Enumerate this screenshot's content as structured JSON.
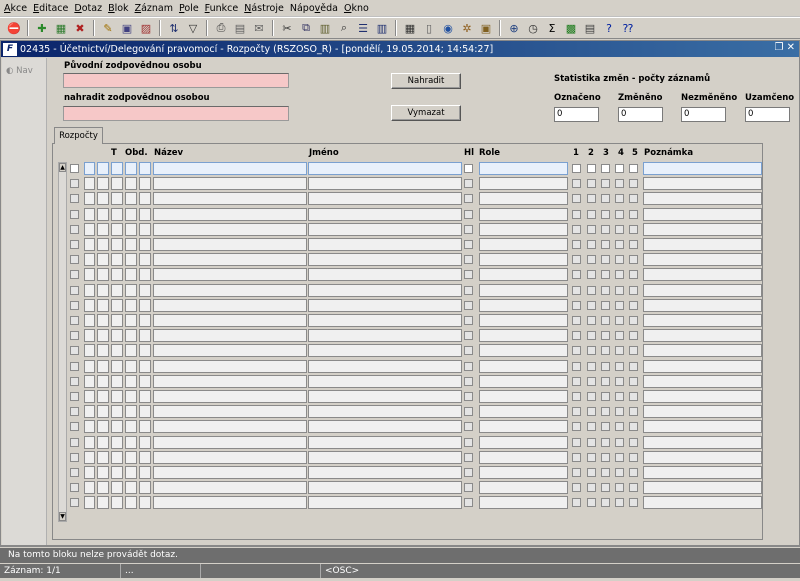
{
  "menu": [
    {
      "id": "akce",
      "pre": "",
      "u": "A",
      "post": "kce"
    },
    {
      "id": "editace",
      "pre": "",
      "u": "E",
      "post": "ditace"
    },
    {
      "id": "dotaz",
      "pre": "",
      "u": "D",
      "post": "otaz"
    },
    {
      "id": "blok",
      "pre": "",
      "u": "B",
      "post": "lok"
    },
    {
      "id": "zaznam",
      "pre": "",
      "u": "Z",
      "post": "áznam"
    },
    {
      "id": "pole",
      "pre": "",
      "u": "P",
      "post": "ole"
    },
    {
      "id": "funkce",
      "pre": "",
      "u": "F",
      "post": "unkce"
    },
    {
      "id": "nastroje",
      "pre": "",
      "u": "N",
      "post": "ástroje"
    },
    {
      "id": "napoveda",
      "pre": "Nápo",
      "u": "v",
      "post": "ěda"
    },
    {
      "id": "okno",
      "pre": "",
      "u": "O",
      "post": "kno"
    }
  ],
  "toolbar": [
    {
      "name": "exit-icon",
      "glyph": "⛔",
      "color": "#cc0000"
    },
    {
      "sep": true
    },
    {
      "name": "new-record-icon",
      "glyph": "✚",
      "color": "#2a8a2a"
    },
    {
      "name": "save-icon",
      "glyph": "▦",
      "color": "#2a7a2a"
    },
    {
      "name": "delete-record-icon",
      "glyph": "✖",
      "color": "#b02020"
    },
    {
      "sep": true
    },
    {
      "name": "enter-query-icon",
      "glyph": "✎",
      "color": "#a07000"
    },
    {
      "name": "execute-query-icon",
      "glyph": "▣",
      "color": "#404080"
    },
    {
      "name": "cancel-query-icon",
      "glyph": "▨",
      "color": "#a03030"
    },
    {
      "sep": true
    },
    {
      "name": "sort-icon",
      "glyph": "⇅",
      "color": "#203070"
    },
    {
      "name": "filter-icon",
      "glyph": "▽",
      "color": "#303030"
    },
    {
      "sep": true
    },
    {
      "name": "print-icon",
      "glyph": "⎙",
      "color": "#404040"
    },
    {
      "name": "attachment-icon",
      "glyph": "▤",
      "color": "#606060"
    },
    {
      "name": "mail-icon",
      "glyph": "✉",
      "color": "#606060"
    },
    {
      "sep": true
    },
    {
      "name": "cut-icon",
      "glyph": "✂",
      "color": "#303030"
    },
    {
      "name": "copy-icon",
      "glyph": "⧉",
      "color": "#303060"
    },
    {
      "name": "paste-icon",
      "glyph": "▥",
      "color": "#606030"
    },
    {
      "name": "search-icon",
      "glyph": "⌕",
      "color": "#303030"
    },
    {
      "name": "list-icon",
      "glyph": "☰",
      "color": "#203070"
    },
    {
      "name": "columns-icon",
      "glyph": "▥",
      "color": "#203070"
    },
    {
      "sep": true
    },
    {
      "name": "calculator-icon",
      "glyph": "▦",
      "color": "#303030"
    },
    {
      "name": "document-icon",
      "glyph": "▯",
      "color": "#606060"
    },
    {
      "name": "globe-icon",
      "glyph": "◉",
      "color": "#2050a0"
    },
    {
      "name": "settings-icon",
      "glyph": "✲",
      "color": "#906020"
    },
    {
      "name": "lock-icon",
      "glyph": "▣",
      "color": "#806020"
    },
    {
      "sep": true
    },
    {
      "name": "zoom-icon",
      "glyph": "⊕",
      "color": "#204080"
    },
    {
      "name": "clock-icon",
      "glyph": "◷",
      "color": "#303030"
    },
    {
      "name": "sum-icon",
      "glyph": "Σ",
      "color": "#000000"
    },
    {
      "name": "excel-icon",
      "glyph": "▩",
      "color": "#1a7a1a"
    },
    {
      "name": "report-icon",
      "glyph": "▤",
      "color": "#404040"
    },
    {
      "name": "help-icon",
      "glyph": "?",
      "color": "#0020a0"
    },
    {
      "name": "context-help-icon",
      "glyph": "⁇",
      "color": "#0020a0"
    }
  ],
  "window": {
    "logo": "F",
    "title": "02435 - Účetnictví/Delegování pravomocí - Rozpočty (RSZOSO_R) - [pondělí, 19.05.2014; 14:54:27]",
    "controls": "❐ ✕"
  },
  "nav": {
    "label": "Nav"
  },
  "form": {
    "original_label": "Původní zodpovědnou osobu",
    "original_value": "",
    "replace_label": "nahradit zodpovědnou osobou",
    "replace_value": "",
    "replace_button": "Nahradit",
    "clear_button": "Vymazat",
    "stats_title": "Statistika změn - počty záznamů",
    "stats": [
      {
        "id": "oznaceno",
        "label": "Označeno",
        "value": "0"
      },
      {
        "id": "zmeneno",
        "label": "Změněno",
        "value": "0"
      },
      {
        "id": "nezmeneno",
        "label": "Nezměněno",
        "value": "0"
      },
      {
        "id": "uzamceno",
        "label": "Uzamčeno",
        "value": "0"
      }
    ]
  },
  "tab": {
    "label": "Rozpočty"
  },
  "grid": {
    "headers": {
      "t": "T",
      "obd": "Obd.",
      "nazev": "Název",
      "jmeno": "Jméno",
      "hl": "Hl",
      "role": "Role",
      "c1": "1",
      "c2": "2",
      "c3": "3",
      "c4": "4",
      "c5": "5",
      "poznamka": "Poznámka"
    },
    "row_count": 23
  },
  "status": {
    "message": "Na tomto bloku nelze provádět dotaz.",
    "record": "Záznam: 1/1",
    "seg2": "...",
    "seg3": "",
    "osc": "<OSC>"
  }
}
